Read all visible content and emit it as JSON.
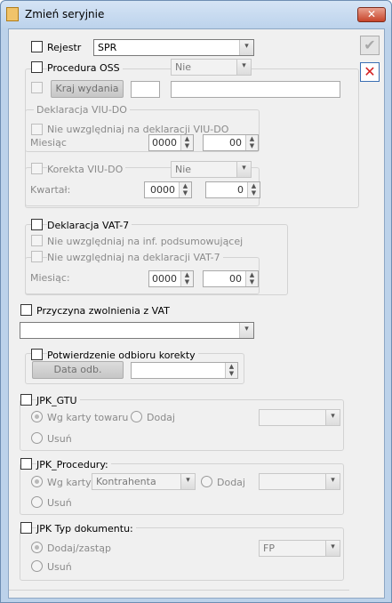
{
  "window": {
    "title": "Zmień seryjnie"
  },
  "rejestr": {
    "label": "Rejestr",
    "value": "SPR"
  },
  "oss": {
    "label": "Procedura OSS",
    "select_value": "Nie",
    "kraj_button": "Kraj wydania",
    "code_value": "",
    "name_value": ""
  },
  "viudo": {
    "group_label": "Deklaracja VIU-DO",
    "ignore_label": "Nie uwzględniaj na deklaracji VIU-DO",
    "month_label": "Miesiąc",
    "year_value": "0000",
    "month_value": "00",
    "correction_label": "Korekta VIU-DO",
    "correction_value": "Nie",
    "quarter_label": "Kwartał:",
    "quarter_year_value": "0000",
    "quarter_value": "0"
  },
  "vat7": {
    "label": "Deklaracja VAT-7",
    "ignore_summary_label": "Nie uwzględniaj na inf. podsumowującej",
    "ignore_decl_label": "Nie uwzględniaj na deklaracji VAT-7",
    "month_label": "Miesiąc:",
    "year_value": "0000",
    "month_value": "00"
  },
  "exemption": {
    "label": "Przyczyna zwolnienia z VAT",
    "value": ""
  },
  "correction_receipt": {
    "label": "Potwierdzenie odbioru korekty",
    "date_button": "Data odb.",
    "date_value": ""
  },
  "jpk_gtu": {
    "label": "JPK_GTU",
    "option1": "Wg karty towaru",
    "option2": "Dodaj",
    "option3": "Usuń",
    "select_value": ""
  },
  "jpk_procedury": {
    "label": "JPK_Procedury:",
    "option1": "Wg karty",
    "karta_value": "Kontrahenta",
    "option2": "Dodaj",
    "option3": "Usuń",
    "select_value": ""
  },
  "jpk_typ": {
    "label": "JPK Typ dokumentu:",
    "option1": "Dodaj/zastąp",
    "option2": "Usuń",
    "select_value": "FP"
  },
  "actions": {
    "ok_icon": "checkmark-icon",
    "cancel_icon": "cancel-x-icon"
  },
  "colors": {
    "title_bar": "#bcd2ea",
    "close_button": "#c7442a",
    "cancel_red": "#d42020"
  }
}
